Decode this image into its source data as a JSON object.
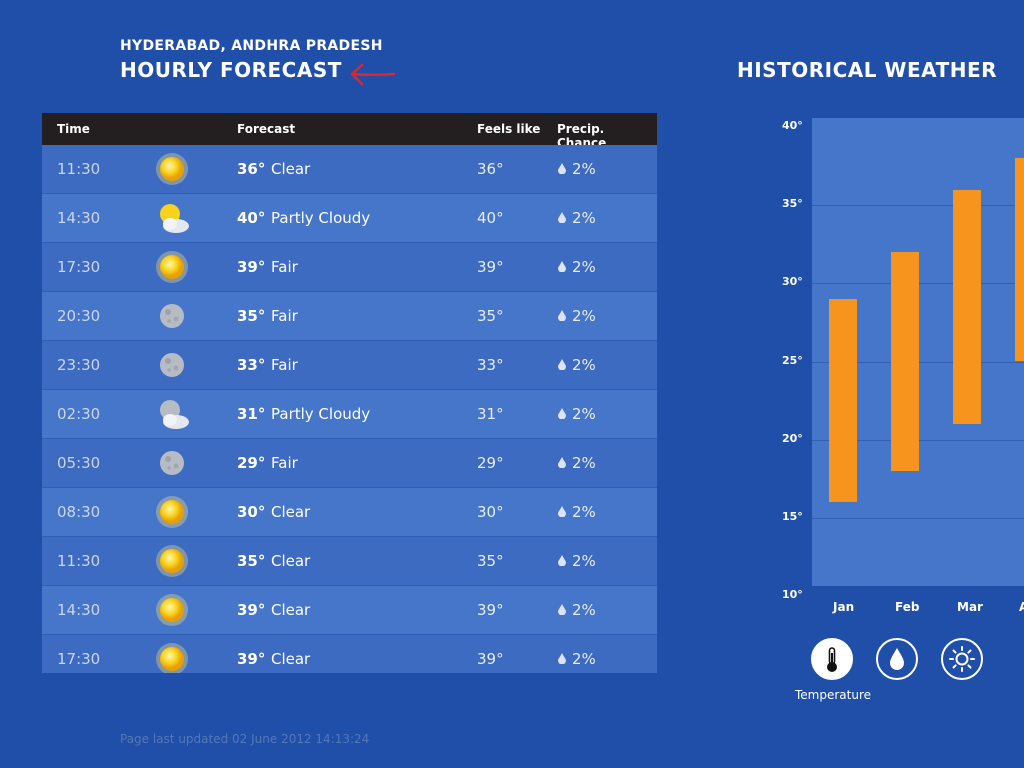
{
  "header": {
    "location": "HYDERABAD, ANDHRA PRADESH",
    "title": "HOURLY FORECAST",
    "historical_title": "HISTORICAL WEATHER"
  },
  "table": {
    "columns": [
      "Time",
      "Forecast",
      "Feels like",
      "Precip. Chance"
    ],
    "rows": [
      {
        "time": "11:30",
        "icon": "sun-icon",
        "temp": "36°",
        "condition": "Clear",
        "feels": "36°",
        "precip": "2%"
      },
      {
        "time": "14:30",
        "icon": "partly-cloudy-day-icon",
        "temp": "40°",
        "condition": "Partly Cloudy",
        "feels": "40°",
        "precip": "2%"
      },
      {
        "time": "17:30",
        "icon": "sun-icon",
        "temp": "39°",
        "condition": "Fair",
        "feels": "39°",
        "precip": "2%"
      },
      {
        "time": "20:30",
        "icon": "moon-icon",
        "temp": "35°",
        "condition": "Fair",
        "feels": "35°",
        "precip": "2%"
      },
      {
        "time": "23:30",
        "icon": "moon-icon",
        "temp": "33°",
        "condition": "Fair",
        "feels": "33°",
        "precip": "2%"
      },
      {
        "time": "02:30",
        "icon": "partly-cloudy-night-icon",
        "temp": "31°",
        "condition": "Partly Cloudy",
        "feels": "31°",
        "precip": "2%"
      },
      {
        "time": "05:30",
        "icon": "moon-icon",
        "temp": "29°",
        "condition": "Fair",
        "feels": "29°",
        "precip": "2%"
      },
      {
        "time": "08:30",
        "icon": "sun-icon",
        "temp": "30°",
        "condition": "Clear",
        "feels": "30°",
        "precip": "2%"
      },
      {
        "time": "11:30",
        "icon": "sun-icon",
        "temp": "35°",
        "condition": "Clear",
        "feels": "35°",
        "precip": "2%"
      },
      {
        "time": "14:30",
        "icon": "sun-icon",
        "temp": "39°",
        "condition": "Clear",
        "feels": "39°",
        "precip": "2%"
      },
      {
        "time": "17:30",
        "icon": "sun-icon",
        "temp": "39°",
        "condition": "Clear",
        "feels": "39°",
        "precip": "2%"
      }
    ]
  },
  "chart_data": {
    "type": "bar",
    "categories": [
      "Jan",
      "Feb",
      "Mar",
      "A"
    ],
    "series": [
      {
        "low": [
          16,
          18,
          21,
          25
        ],
        "high": [
          29,
          32,
          36,
          38
        ]
      }
    ],
    "y_ticks": [
      "40°",
      "35°",
      "30°",
      "25°",
      "20°",
      "15°",
      "10°"
    ],
    "ylim": [
      10,
      40
    ],
    "grid": true,
    "bar_color": "#f7941d"
  },
  "chart_buttons": {
    "items": [
      "temperature-icon",
      "raindrop-icon",
      "sun-icon"
    ],
    "active_label": "Temperature"
  },
  "footer": {
    "updated": "Page last updated 02 June 2012 14:13:24"
  },
  "colors": {
    "background": "#1f4fa8",
    "accent": "#f7941d",
    "arrow": "#e0262b"
  }
}
